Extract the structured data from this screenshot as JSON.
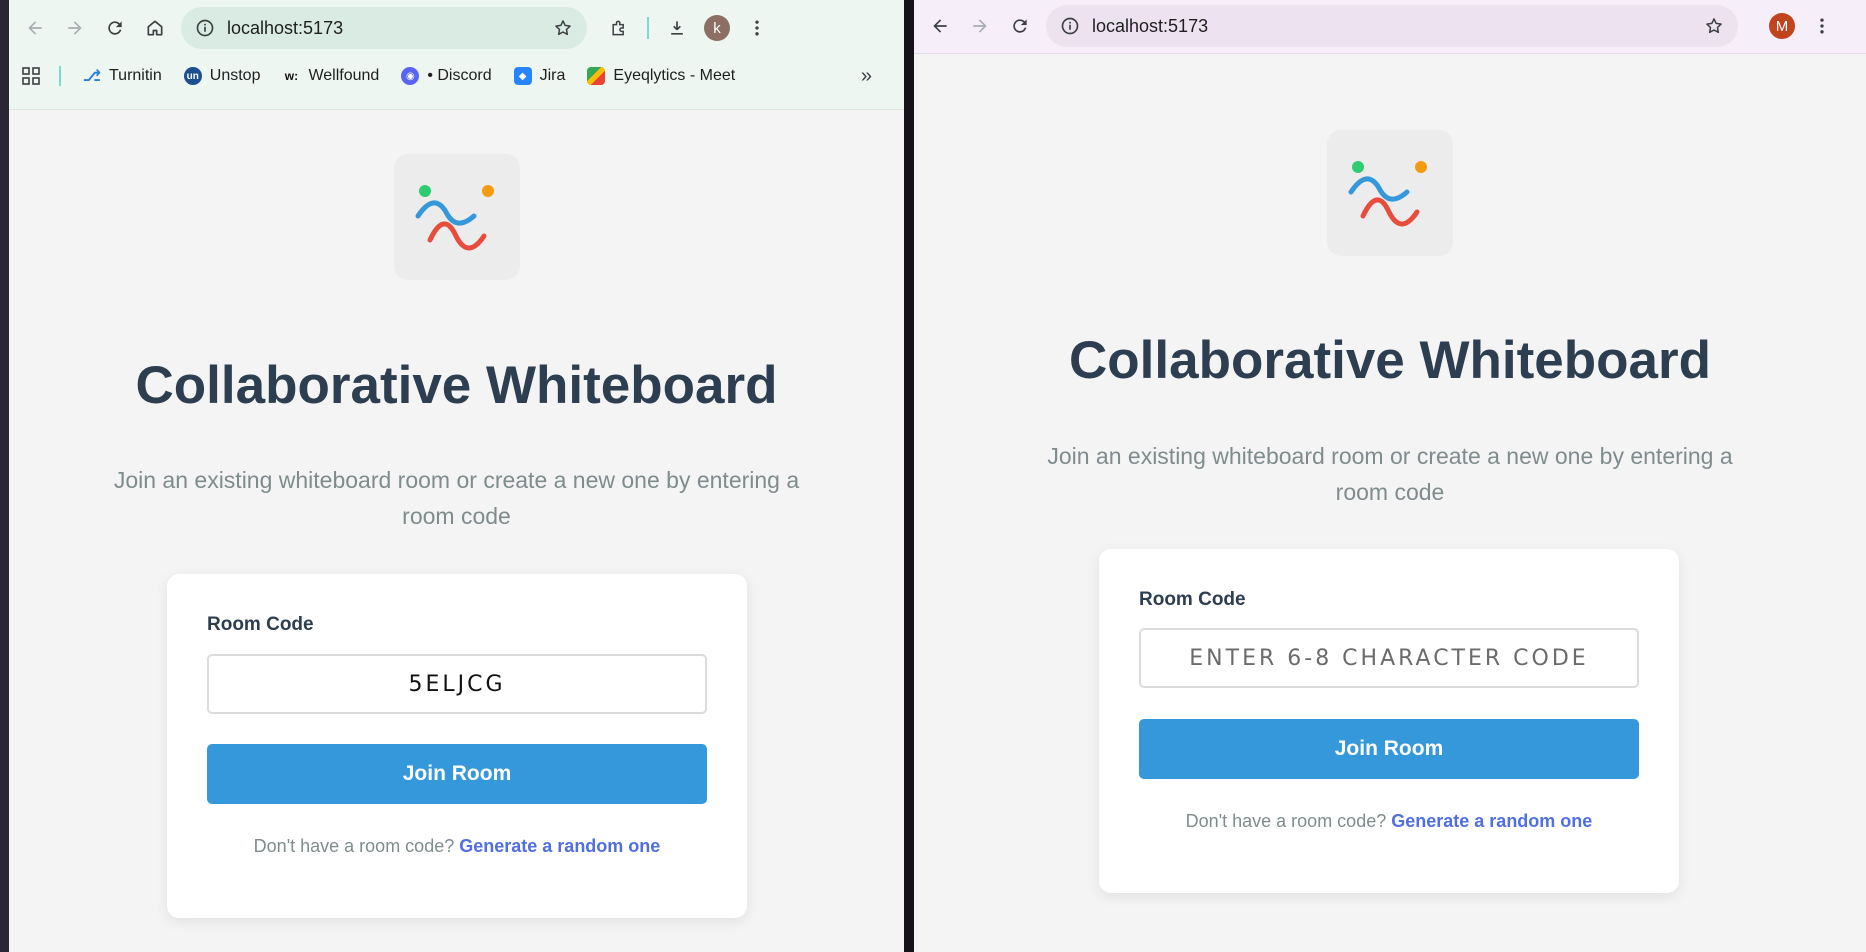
{
  "left_window": {
    "url": "localhost:5173",
    "avatar_letter": "k",
    "bookmarks": [
      {
        "label": "Turnitin",
        "icon": "turnitin-icon"
      },
      {
        "label": "Unstop",
        "icon": "unstop-icon"
      },
      {
        "label": "Wellfound",
        "icon": "wellfound-icon"
      },
      {
        "label": "• Discord",
        "icon": "discord-icon"
      },
      {
        "label": "Jira",
        "icon": "jira-icon"
      },
      {
        "label": "Eyeqlytics - Meet",
        "icon": "google-meet-icon"
      }
    ],
    "page": {
      "title": "Collaborative Whiteboard",
      "subtitle": "Join an existing whiteboard room or create a new one by entering a room code",
      "room_code_label": "Room Code",
      "room_code_value": "5ELJCG",
      "join_button": "Join Room",
      "helper_text": "Don't have a room code?",
      "helper_link": "Generate a random one"
    }
  },
  "right_window": {
    "url": "localhost:5173",
    "avatar_letter": "M",
    "page": {
      "title": "Collaborative Whiteboard",
      "subtitle": "Join an existing whiteboard room or create a new one by entering a room code",
      "room_code_label": "Room Code",
      "room_code_placeholder": "ENTER 6-8 CHARACTER CODE",
      "join_button": "Join Room",
      "helper_text": "Don't have a room code?",
      "helper_link": "Generate a random one"
    }
  },
  "colors": {
    "accent": "#3498db",
    "title": "#2c3e50",
    "link": "#4f6fe3",
    "logo_blue": "#3498db",
    "logo_red": "#e74c3c",
    "logo_green": "#2ecc71",
    "logo_orange": "#f39c12"
  }
}
